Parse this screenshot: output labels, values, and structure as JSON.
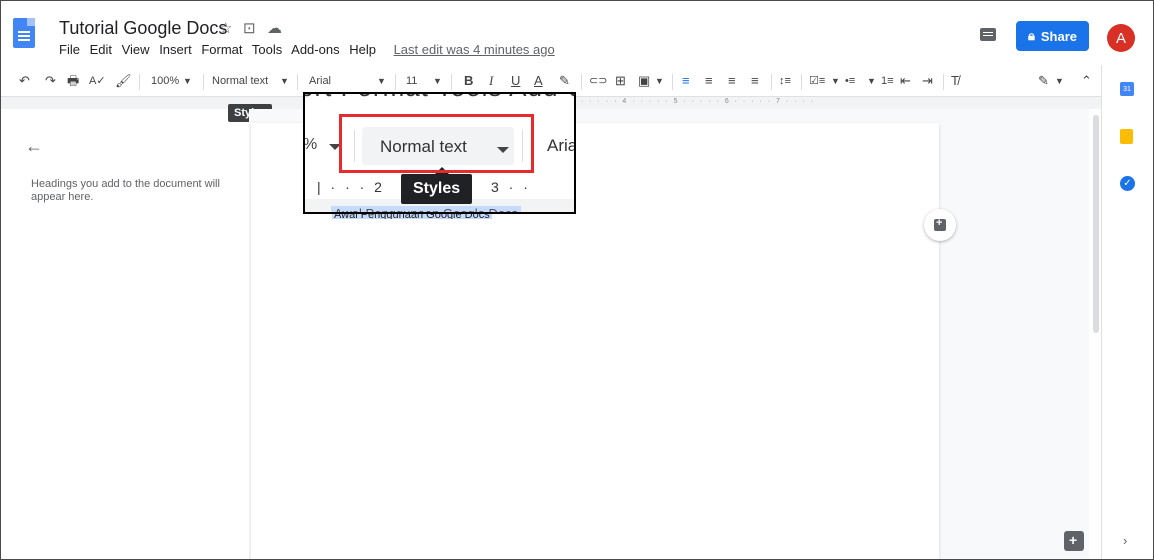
{
  "header": {
    "title": "Tutorial Google Docs",
    "star_icon": "☆",
    "move_icon": "⊡",
    "cloud_icon": "☁",
    "menus": [
      "File",
      "Edit",
      "View",
      "Insert",
      "Format",
      "Tools",
      "Add-ons",
      "Help"
    ],
    "last_edit": "Last edit was 4 minutes ago",
    "share_label": "Share",
    "avatar_letter": "A"
  },
  "toolbar": {
    "undo": "↶",
    "redo": "↷",
    "print": "🖶",
    "spellcheck": "A✓",
    "paint_format": "🖌",
    "zoom": "100%",
    "style": "Normal text",
    "font": "Arial",
    "font_size": "11",
    "bold": "B",
    "italic": "I",
    "underline": "U",
    "text_color": "A",
    "highlight": "✎",
    "link": "⊂⊃",
    "comment": "⊞",
    "image": "▣",
    "align_left": "≡",
    "align_center": "≡",
    "align_right": "≡",
    "align_justify": "≡",
    "line_spacing": "↕≡",
    "checklist": "☑≡",
    "bullets": "•≡",
    "numbered": "1≡",
    "outdent": "⇤",
    "indent": "⇥",
    "clear_format": "T̸",
    "editing_mode": "✎",
    "collapse": "⌃",
    "styles_tooltip": "Styles"
  },
  "ruler": {
    "ticks": "· · · · · 4 · · · · · 5 · · · · · 6 · · · · · 7 · · · ·"
  },
  "outline": {
    "back_icon": "←",
    "hint": "Headings you add to the document will appear here."
  },
  "document": {
    "body_text": "Awal Penggunaan Google Docs"
  },
  "zoom_overlay": {
    "menu_text": "sert   Format   Tools   Add-o",
    "zoom_fragment": "%",
    "style_label": "Normal text",
    "font_fragment": "Aria",
    "ruler_left": "|  ·  ·  ·  2",
    "ruler_right": "3  ·  ·",
    "tooltip": "Styles",
    "doc_fragment": "Awal Penggunaan Google Docs"
  },
  "side_panel": {
    "calendar_label": "31",
    "tasks_label": "✓",
    "toggle_icon": "›"
  },
  "colors": {
    "share_blue": "#1a73e8",
    "highlight_red": "#e52b2b",
    "avatar_red": "#d93025",
    "docs_blue": "#4285f4"
  }
}
